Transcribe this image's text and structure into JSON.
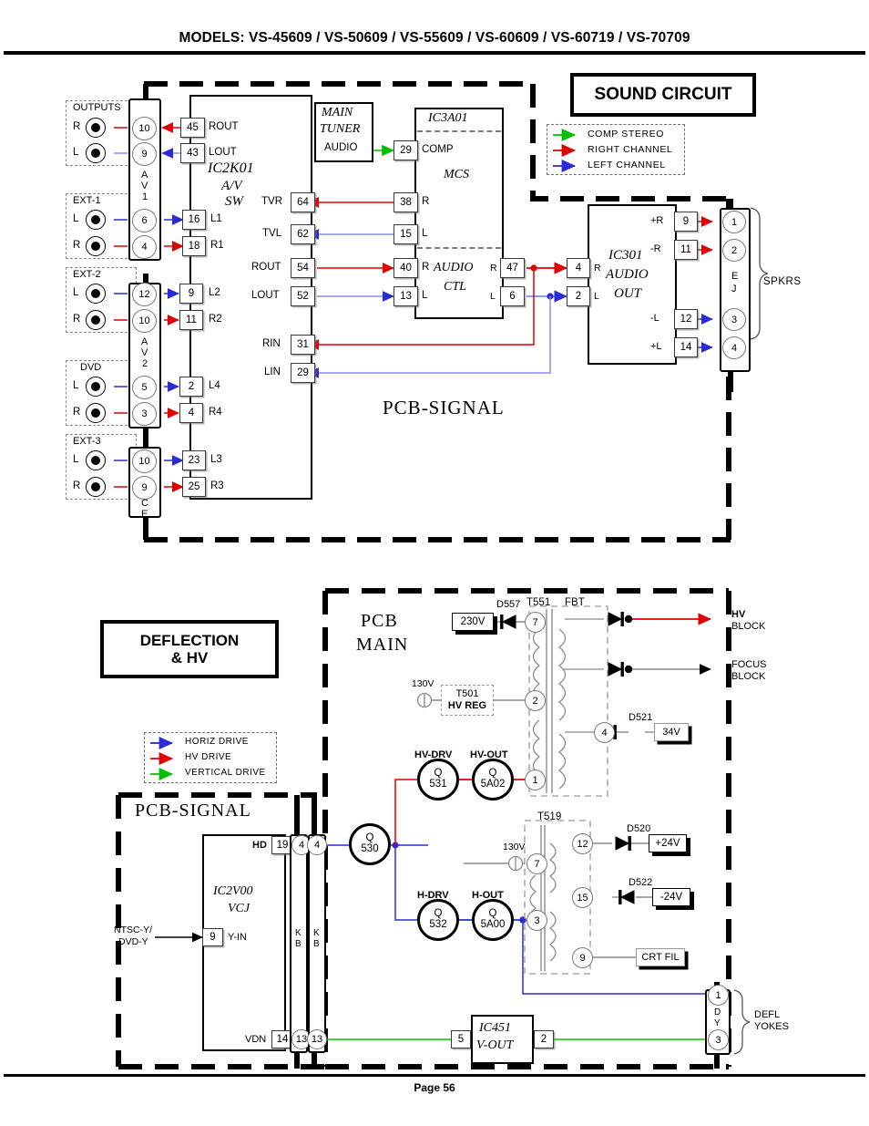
{
  "header": {
    "models_title": "MODELS: VS-45609 / VS-50609 / VS-55609 / VS-60609 / VS-60719 / VS-70709"
  },
  "footer": {
    "page_label": "Page 56"
  },
  "colors": {
    "right_channel": "#e00000",
    "left_channel": "#3b3bdb",
    "comp_stereo": "#00c000",
    "horiz_drive": "#2020c8",
    "hv_drive": "#e00000",
    "vertical_drive": "#00c000",
    "wire_gray": "#8a8a8a",
    "ink": "#000000"
  },
  "sound": {
    "block_title": "SOUND CIRCUIT",
    "pcb_label": "PCB-SIGNAL",
    "legend": [
      {
        "label": "COMP STEREO",
        "color": "#00c000"
      },
      {
        "label": "RIGHT CHANNEL",
        "color": "#e00000"
      },
      {
        "label": "LEFT CHANNEL",
        "color": "#3b3bdb"
      }
    ],
    "jack_groups": [
      {
        "name": "OUTPUTS",
        "rows": [
          {
            "ch": "R"
          },
          {
            "ch": "L"
          }
        ]
      },
      {
        "name": "EXT-1",
        "rows": [
          {
            "ch": "L"
          },
          {
            "ch": "R"
          }
        ]
      },
      {
        "name": "EXT-2",
        "rows": [
          {
            "ch": "L"
          },
          {
            "ch": "R"
          }
        ]
      },
      {
        "name": "DVD",
        "rows": [
          {
            "ch": "L"
          },
          {
            "ch": "R"
          }
        ]
      },
      {
        "name": "EXT-3",
        "rows": [
          {
            "ch": "L"
          },
          {
            "ch": "R"
          }
        ]
      }
    ],
    "connectors": [
      {
        "name": "AV1",
        "stack": [
          "A",
          "V",
          "1"
        ],
        "pins": [
          "10",
          "9",
          "6",
          "4"
        ]
      },
      {
        "name": "AV2",
        "stack": [
          "A",
          "V",
          "2"
        ],
        "pins": [
          "12",
          "10",
          "5",
          "3"
        ]
      },
      {
        "name": "CE",
        "stack": [
          "C",
          "E"
        ],
        "pins": [
          "10",
          "9"
        ]
      }
    ],
    "ic2k01": {
      "name": "IC2K01",
      "sub1": "A/V",
      "sub2": "SW",
      "left_pins": [
        {
          "pin": "45",
          "label": "ROUT",
          "color": "#e00000",
          "dir": "out"
        },
        {
          "pin": "43",
          "label": "LOUT",
          "color": "#3b3bdb",
          "dir": "out"
        },
        {
          "pin": "16",
          "label": "L1",
          "color": "#3b3bdb",
          "dir": "in"
        },
        {
          "pin": "18",
          "label": "R1",
          "color": "#e00000",
          "dir": "in"
        },
        {
          "pin": "9",
          "label": "L2",
          "color": "#3b3bdb",
          "dir": "in"
        },
        {
          "pin": "11",
          "label": "R2",
          "color": "#e00000",
          "dir": "in"
        },
        {
          "pin": "2",
          "label": "L4",
          "color": "#3b3bdb",
          "dir": "in"
        },
        {
          "pin": "4",
          "label": "R4",
          "color": "#e00000",
          "dir": "in"
        },
        {
          "pin": "23",
          "label": "L3",
          "color": "#3b3bdb",
          "dir": "in"
        },
        {
          "pin": "25",
          "label": "R3",
          "color": "#e00000",
          "dir": "in"
        }
      ],
      "right_pins": [
        {
          "pin": "64",
          "label": "TVR",
          "color": "#e00000"
        },
        {
          "pin": "62",
          "label": "TVL",
          "color": "#3b3bdb"
        },
        {
          "pin": "54",
          "label": "ROUT",
          "color": "#e00000"
        },
        {
          "pin": "52",
          "label": "LOUT",
          "color": "#3b3bdb"
        },
        {
          "pin": "31",
          "label": "RIN",
          "color": "#e00000"
        },
        {
          "pin": "29",
          "label": "LIN",
          "color": "#3b3bdb"
        }
      ]
    },
    "main_tuner": {
      "line1": "MAIN",
      "line2": "TUNER",
      "line3": "AUDIO"
    },
    "ic3a01": {
      "name": "IC3A01",
      "mcs": "MCS",
      "audio_ctl1": "AUDIO",
      "audio_ctl2": "CTL",
      "pins": [
        {
          "pin": "29",
          "label": "COMP"
        },
        {
          "pin": "38",
          "label": "R"
        },
        {
          "pin": "15",
          "label": "L"
        },
        {
          "pin": "40",
          "label": "R"
        },
        {
          "pin": "13",
          "label": "L"
        }
      ],
      "out_pins": [
        {
          "pin": "47",
          "label": "R"
        },
        {
          "pin": "6",
          "label": "L"
        }
      ]
    },
    "ic301": {
      "name": "IC301",
      "line2": "AUDIO",
      "line3": "OUT",
      "in_pins": [
        {
          "pin": "4",
          "label": "R"
        },
        {
          "pin": "2",
          "label": "L"
        }
      ],
      "out_pins": [
        {
          "pin": "9",
          "label": "+R",
          "color": "#e00000"
        },
        {
          "pin": "11",
          "label": "-R",
          "color": "#e00000"
        },
        {
          "pin": "12",
          "label": "-L",
          "color": "#3b3bdb"
        },
        {
          "pin": "14",
          "label": "+L",
          "color": "#3b3bdb"
        }
      ]
    },
    "spkr_conn": {
      "stack": [
        "E",
        "J"
      ],
      "pins": [
        "1",
        "2",
        "3",
        "4"
      ],
      "label": "SPKRS"
    }
  },
  "deflection": {
    "block_title_l1": "DEFLECTION",
    "block_title_l2": "& HV",
    "legend": [
      {
        "label": "HORIZ DRIVE",
        "color": "#2020c8"
      },
      {
        "label": "HV DRIVE",
        "color": "#e00000"
      },
      {
        "label": "VERTICAL DRIVE",
        "color": "#00c000"
      }
    ],
    "pcb_main_l1": "PCB",
    "pcb_main_l2": "MAIN",
    "pcb_signal": "PCB-SIGNAL",
    "ic2v00": {
      "name": "IC2V00",
      "sub": "VCJ",
      "pins": [
        {
          "pin": "19",
          "label": "HD"
        },
        {
          "pin": "9",
          "label": "Y-IN"
        },
        {
          "pin": "14",
          "label": "VDN"
        }
      ],
      "input_label_l1": "NTSC-Y/",
      "input_label_l2": "DVD-Y"
    },
    "kb_connectors": [
      {
        "name": "KB",
        "stack": [
          "K",
          "B"
        ],
        "pins": [
          "4",
          "13"
        ]
      },
      {
        "name": "KB",
        "stack": [
          "K",
          "B"
        ],
        "pins": [
          "4",
          "13"
        ]
      }
    ],
    "transistors": [
      {
        "ref": "Q",
        "num": "530",
        "caption": ""
      },
      {
        "ref": "Q",
        "num": "531",
        "caption": "HV-DRV"
      },
      {
        "ref": "Q",
        "num": "5A02",
        "caption": "HV-OUT"
      },
      {
        "ref": "Q",
        "num": "532",
        "caption": "H-DRV"
      },
      {
        "ref": "Q",
        "num": "5A00",
        "caption": "H-OUT"
      }
    ],
    "t551": {
      "name": "T551",
      "tag": "FBT",
      "pins": [
        "7",
        "2",
        "4",
        "1"
      ],
      "outputs": [
        {
          "label_l1": "HV",
          "label_l2": "BLOCK",
          "color": "#e00000"
        },
        {
          "label_l1": "FOCUS",
          "label_l2": "BLOCK",
          "color": "#8a8a8a"
        }
      ]
    },
    "t519": {
      "name": "T519",
      "pins": [
        "12",
        "7",
        "15",
        "3",
        "9"
      ]
    },
    "t501": {
      "name": "T501",
      "sub": "HV REG",
      "src": "130V"
    },
    "voltages": [
      {
        "label": "230V"
      },
      {
        "label": "34V"
      },
      {
        "label": "+24V"
      },
      {
        "label": "-24V"
      },
      {
        "label": "CRT FIL"
      },
      {
        "label": "130V"
      }
    ],
    "diodes": [
      "D557",
      "D521",
      "D520",
      "D522"
    ],
    "ic451": {
      "name": "IC451",
      "sub": "V-OUT",
      "pin_in": "5",
      "pin_out": "2"
    },
    "dy_conn": {
      "stack": [
        "D",
        "Y"
      ],
      "pins": [
        "1",
        "3"
      ],
      "label_l1": "DEFL",
      "label_l2": "YOKES"
    }
  }
}
